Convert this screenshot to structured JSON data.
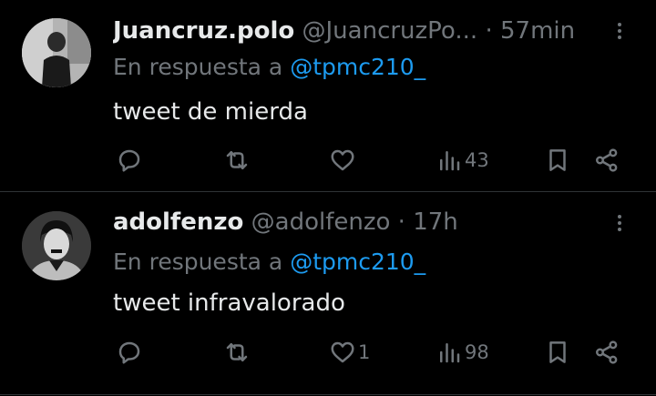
{
  "tweets": [
    {
      "name": "Juancruz.polo",
      "handle": "@JuancruzPo...",
      "separator": "·",
      "time": "57min",
      "reply_prefix": "En respuesta a",
      "reply_to": "@tpmc210_",
      "text": "tweet de mierda",
      "likes": "",
      "views": "43",
      "icons": {
        "reply": "reply-icon",
        "retweet": "retweet-icon",
        "like": "heart-icon",
        "views": "views-icon",
        "bookmark": "bookmark-icon",
        "share": "share-icon"
      }
    },
    {
      "name": "adolfenzo",
      "handle": "@adolfenzo",
      "separator": "·",
      "time": "17h",
      "reply_prefix": "En respuesta a",
      "reply_to": "@tpmc210_",
      "text": "tweet infravalorado",
      "likes": "1",
      "views": "98",
      "icons": {
        "reply": "reply-icon",
        "retweet": "retweet-icon",
        "like": "heart-icon",
        "views": "views-icon",
        "bookmark": "bookmark-icon",
        "share": "share-icon"
      }
    }
  ],
  "colors": {
    "background": "#000000",
    "primary_text": "#e7e9ea",
    "secondary_text": "#71767b",
    "mention": "#1d9bf0",
    "divider": "#2f3336"
  }
}
